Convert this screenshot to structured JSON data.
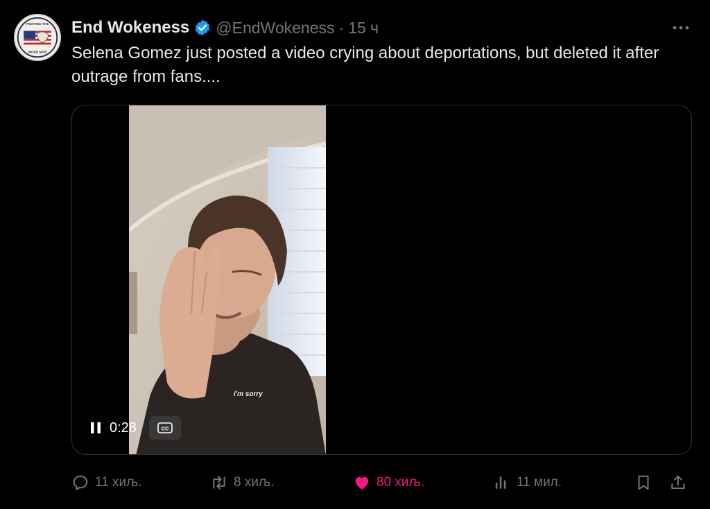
{
  "tweet": {
    "display_name": "End Wokeness",
    "handle": "@EndWokeness",
    "separator": "·",
    "time": "15 ч",
    "text": "Selena Gomez just posted a video crying about deportations, but deleted it after outrage from fans....",
    "avatar_text_top": "FIGHTING THE",
    "avatar_text_bottom": "WOKE MOB"
  },
  "video": {
    "caption": "i'm sorry",
    "elapsed": "0:28",
    "cc_label": "CC"
  },
  "actions": {
    "reply_count": "11 хиљ.",
    "retweet_count": "8 хиљ.",
    "like_count": "80 хиљ.",
    "views_count": "11 мил."
  },
  "icons": {
    "verified": "verified-badge-icon",
    "more": "more-icon",
    "pause": "pause-icon",
    "cc": "closed-captions-icon",
    "reply": "reply-icon",
    "retweet": "retweet-icon",
    "like": "heart-icon",
    "views": "views-icon",
    "bookmark": "bookmark-icon",
    "share": "share-icon"
  },
  "colors": {
    "background": "#000000",
    "text": "#e7e9ea",
    "secondary": "#71767b",
    "verified": "#1d9bf0",
    "like": "#f91880"
  }
}
